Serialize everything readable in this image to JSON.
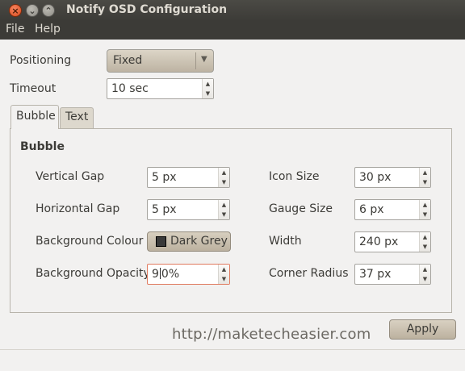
{
  "window": {
    "title": "Notify OSD Configuration"
  },
  "menu": {
    "file": "File",
    "help": "Help"
  },
  "positioning": {
    "label": "Positioning",
    "value": "Fixed"
  },
  "timeout": {
    "label": "Timeout",
    "value": "10 sec"
  },
  "tabs": [
    {
      "label": "Bubble"
    },
    {
      "label": "Text"
    }
  ],
  "bubble": {
    "section_title": "Bubble",
    "vertical_gap": {
      "label": "Vertical Gap",
      "value": "5 px"
    },
    "horizontal_gap": {
      "label": "Horizontal Gap",
      "value": "5 px"
    },
    "background_colour": {
      "label": "Background Colour",
      "value": "Dark Grey",
      "swatch_color": "#3a3a3a"
    },
    "background_opacity": {
      "label": "Background Opacity",
      "value_before_caret": "9",
      "value_after_caret": "0%"
    },
    "icon_size": {
      "label": "Icon Size",
      "value": "30 px"
    },
    "gauge_size": {
      "label": "Gauge Size",
      "value": "6 px"
    },
    "width": {
      "label": "Width",
      "value": "240 px"
    },
    "corner_radius": {
      "label": "Corner Radius",
      "value": "37 px"
    }
  },
  "watermark": "http://maketecheasier.com",
  "apply_label": "Apply",
  "icons": {
    "close": "×",
    "minimize": "⌄",
    "maximize": "⌃",
    "dropdown": "▼",
    "spin_up": "▲",
    "spin_down": "▼"
  }
}
